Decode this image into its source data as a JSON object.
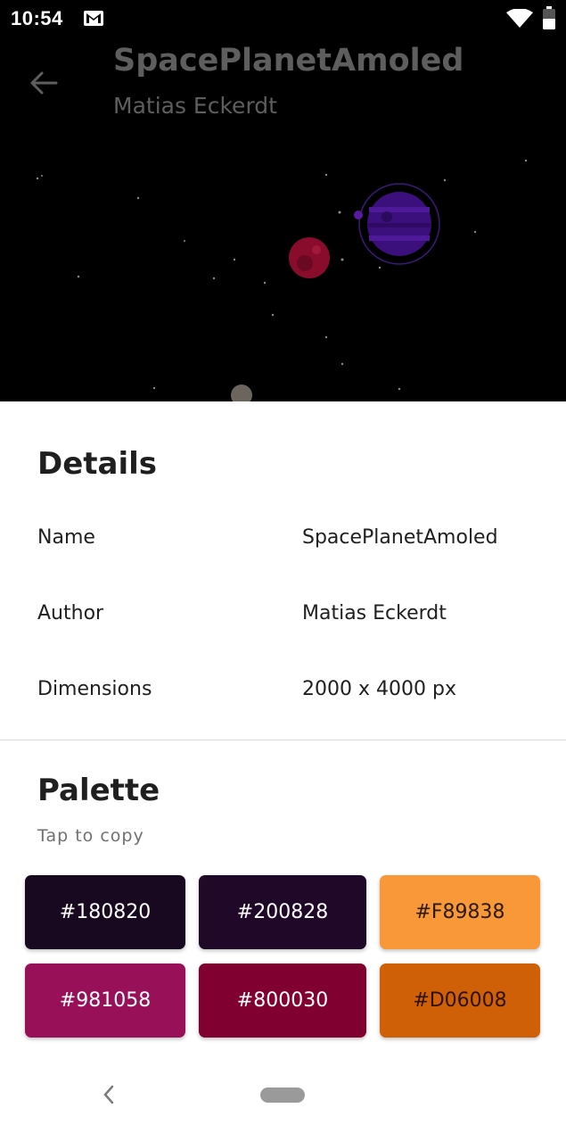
{
  "status_bar": {
    "time": "10:54",
    "icons": [
      "gmail-icon",
      "wifi-icon",
      "battery-icon"
    ]
  },
  "header": {
    "back_icon": "arrow-left-icon",
    "title": "SpacePlanetAmoled",
    "subtitle": "Matias Eckerdt"
  },
  "details": {
    "title": "Details",
    "rows": [
      {
        "label": "Name",
        "value": "SpacePlanetAmoled"
      },
      {
        "label": "Author",
        "value": "Matias Eckerdt"
      },
      {
        "label": "Dimensions",
        "value": "2000 x 4000 px"
      }
    ]
  },
  "palette": {
    "title": "Palette",
    "hint": "Tap to copy",
    "swatches": [
      {
        "label": "#180820",
        "color": "#180820",
        "text_color": "#ffffff"
      },
      {
        "label": "#200828",
        "color": "#200828",
        "text_color": "#ffffff"
      },
      {
        "label": "#F89838",
        "color": "#F89838",
        "text_color": "#2a1a08"
      },
      {
        "label": "#981058",
        "color": "#981058",
        "text_color": "#ffffff"
      },
      {
        "label": "#800030",
        "color": "#800030",
        "text_color": "#ffffff"
      },
      {
        "label": "#D06008",
        "color": "#D06008",
        "text_color": "#2a1206"
      }
    ]
  },
  "nav_bar": {
    "back_icon": "chevron-left-icon",
    "home_icon": "home-pill-icon"
  }
}
